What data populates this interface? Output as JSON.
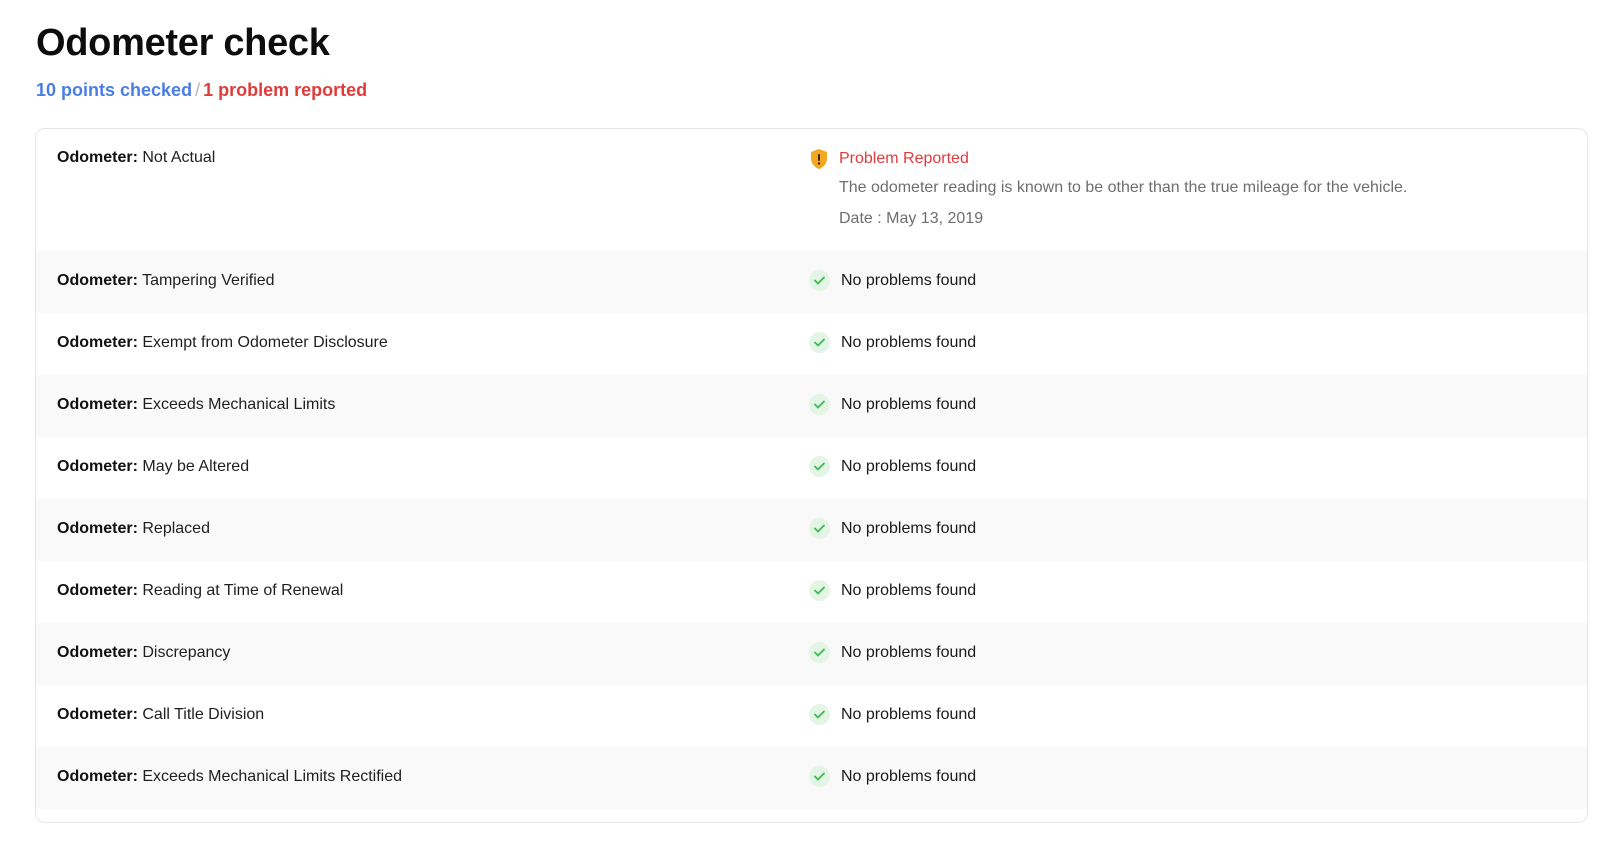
{
  "header": {
    "title": "Odometer check",
    "points_checked": "10 points checked",
    "separator": "/",
    "problems_reported": "1 problem reported"
  },
  "colors": {
    "points_checked": "#4a7ee3",
    "problems_reported": "#e03b3b",
    "ok_check": "#3fb950",
    "warning": "#f2a91f"
  },
  "rows": [
    {
      "key": "Odometer:",
      "value": "Not Actual",
      "status": "Problem Reported",
      "status_icon": "warning-shield-icon",
      "description": "The odometer reading is known to be other than the true mileage for the vehicle.",
      "date": "Date : May 13, 2019"
    },
    {
      "key": "Odometer:",
      "value": "Tampering Verified",
      "status": "No problems found",
      "status_icon": "check-icon"
    },
    {
      "key": "Odometer:",
      "value": "Exempt from Odometer Disclosure",
      "status": "No problems found",
      "status_icon": "check-icon"
    },
    {
      "key": "Odometer:",
      "value": "Exceeds Mechanical Limits",
      "status": "No problems found",
      "status_icon": "check-icon"
    },
    {
      "key": "Odometer:",
      "value": "May be Altered",
      "status": "No problems found",
      "status_icon": "check-icon"
    },
    {
      "key": "Odometer:",
      "value": "Replaced",
      "status": "No problems found",
      "status_icon": "check-icon"
    },
    {
      "key": "Odometer:",
      "value": "Reading at Time of Renewal",
      "status": "No problems found",
      "status_icon": "check-icon"
    },
    {
      "key": "Odometer:",
      "value": "Discrepancy",
      "status": "No problems found",
      "status_icon": "check-icon"
    },
    {
      "key": "Odometer:",
      "value": "Call Title Division",
      "status": "No problems found",
      "status_icon": "check-icon"
    },
    {
      "key": "Odometer:",
      "value": "Exceeds Mechanical Limits Rectified",
      "status": "No problems found",
      "status_icon": "check-icon"
    }
  ]
}
